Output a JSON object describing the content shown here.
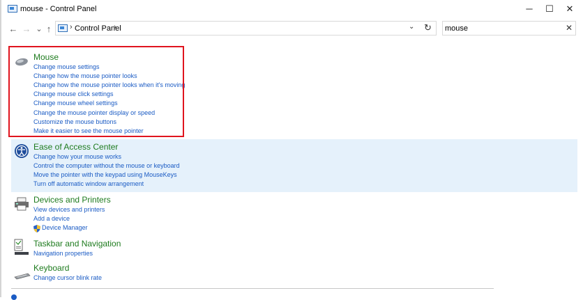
{
  "window": {
    "title": "mouse - Control Panel",
    "minimize": "─",
    "maximize": "☐",
    "close": "✕"
  },
  "nav": {
    "back": "←",
    "forward": "→",
    "recent": "⌄",
    "up": "↑",
    "breadcrumb_sep": "›",
    "breadcrumb": "Control Panel",
    "breadcrumb_sep2": "›",
    "dropdown": "⌄",
    "refresh": "↻",
    "search_value": "mouse",
    "search_clear": "✕"
  },
  "groups": [
    {
      "title": "Mouse",
      "icon": "mouse-icon",
      "links": [
        "Change mouse settings",
        "Change how the mouse pointer looks",
        "Change how the mouse pointer looks when it's moving",
        "Change mouse click settings",
        "Change mouse wheel settings",
        "Change the mouse pointer display or speed",
        "Customize the mouse buttons",
        "Make it easier to see the mouse pointer"
      ]
    },
    {
      "title": "Ease of Access Center",
      "icon": "ease-of-access-icon",
      "links": [
        "Change how your mouse works",
        "Control the computer without the mouse or keyboard",
        "Move the pointer with the keypad using MouseKeys",
        "Turn off automatic window arrangement"
      ]
    },
    {
      "title": "Devices and Printers",
      "icon": "printer-icon",
      "links": [
        "View devices and printers",
        "Add a device",
        "Device Manager"
      ]
    },
    {
      "title": "Taskbar and Navigation",
      "icon": "taskbar-icon",
      "links": [
        "Navigation properties"
      ]
    },
    {
      "title": "Keyboard",
      "icon": "keyboard-icon",
      "links": [
        "Change cursor blink rate"
      ]
    }
  ],
  "colors": {
    "title_green": "#1e7b1e",
    "link_blue": "#1a5bc4",
    "highlight": "#e5f1fb",
    "red_box": "#e0141e"
  }
}
